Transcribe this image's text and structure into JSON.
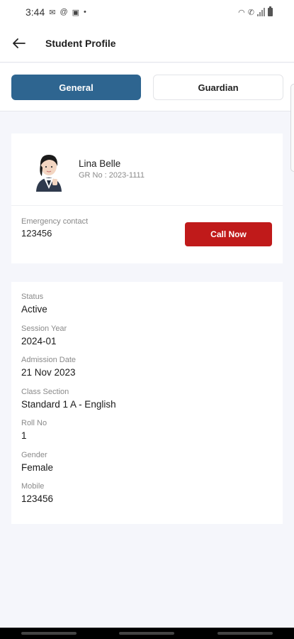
{
  "status_bar": {
    "time": "3:44"
  },
  "app_bar": {
    "title": "Student Profile"
  },
  "tabs": [
    {
      "label": "General",
      "active": true
    },
    {
      "label": "Guardian",
      "active": false
    }
  ],
  "profile": {
    "name": "Lina Belle",
    "gr_no": "GR No : 2023-1111",
    "emergency_label": "Emergency contact",
    "emergency_value": "123456",
    "call_label": "Call Now"
  },
  "details": [
    {
      "label": "Status",
      "value": "Active"
    },
    {
      "label": "Session Year",
      "value": "2024-01"
    },
    {
      "label": "Admission Date",
      "value": "21 Nov 2023"
    },
    {
      "label": "Class Section",
      "value": "Standard 1 A - English"
    },
    {
      "label": "Roll No",
      "value": "1"
    },
    {
      "label": "Gender",
      "value": "Female"
    },
    {
      "label": "Mobile",
      "value": "123456"
    }
  ],
  "colors": {
    "primary": "#2e6590",
    "danger": "#c01a1a",
    "background": "#f5f6fb"
  }
}
